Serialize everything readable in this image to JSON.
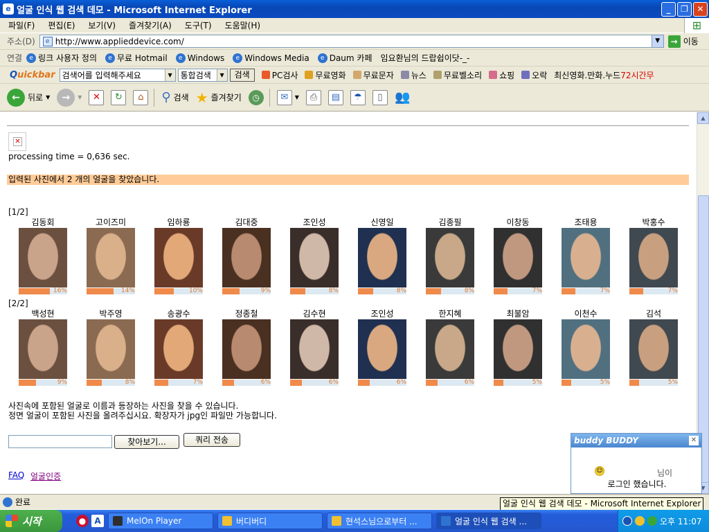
{
  "window": {
    "title": "얼굴 인식 웹 검색 데모 - Microsoft Internet Explorer",
    "icon": "ie-icon",
    "buttons": {
      "minimize": "_",
      "restore": "❐",
      "close": "✕"
    }
  },
  "menu": {
    "items": [
      "파일(F)",
      "편집(E)",
      "보기(V)",
      "즐겨찾기(A)",
      "도구(T)",
      "도움말(H)"
    ]
  },
  "address": {
    "label": "주소(D)",
    "url": "http://www.applieddevice.com/",
    "go_label": "이동"
  },
  "links": {
    "label": "연결",
    "items": [
      "링크 사용자 정의",
      "무료 Hotmail",
      "Windows",
      "Windows Media",
      "Daum 카페"
    ],
    "extra_text": "임요환님의 드랍쉽이닷-_-"
  },
  "quickbar": {
    "logo_q": "Q",
    "logo_rest": "uickbar",
    "search_placeholder": "검색어를 입력해주세요",
    "search_scope": "통합검색",
    "search_button": "검색",
    "items": [
      "PC검사",
      "무료영화",
      "무료문자",
      "뉴스",
      "무료벨소리",
      "쇼핑",
      "오락"
    ],
    "promo_text": "최신영화.만화.누드",
    "promo_red": "72시간무"
  },
  "toolbar": {
    "back_label": "뒤로",
    "search_label": "검색",
    "favorites_label": "즐겨찾기"
  },
  "page": {
    "processing_time": "processing time = 0,636 sec.",
    "found_text": "입력된 사진에서 2 개의 얼굴을 찾았습니다.",
    "group1_label": "[1/2]",
    "group2_label": "[2/2]",
    "group1": [
      {
        "name": "김동회",
        "pct": 16,
        "pct_label": "16%"
      },
      {
        "name": "고이즈미",
        "pct": 14,
        "pct_label": "14%"
      },
      {
        "name": "임하룡",
        "pct": 10,
        "pct_label": "10%"
      },
      {
        "name": "김대중",
        "pct": 9,
        "pct_label": "9%"
      },
      {
        "name": "조인성",
        "pct": 8,
        "pct_label": "8%"
      },
      {
        "name": "신영일",
        "pct": 8,
        "pct_label": "8%"
      },
      {
        "name": "김종필",
        "pct": 8,
        "pct_label": "8%"
      },
      {
        "name": "이창동",
        "pct": 7,
        "pct_label": "7%"
      },
      {
        "name": "조태용",
        "pct": 7,
        "pct_label": "7%"
      },
      {
        "name": "박홍수",
        "pct": 7,
        "pct_label": "7%"
      }
    ],
    "group2": [
      {
        "name": "백성현",
        "pct": 9,
        "pct_label": "9%"
      },
      {
        "name": "박주영",
        "pct": 8,
        "pct_label": "8%"
      },
      {
        "name": "송광수",
        "pct": 7,
        "pct_label": "7%"
      },
      {
        "name": "정종철",
        "pct": 6,
        "pct_label": "6%"
      },
      {
        "name": "김수현",
        "pct": 6,
        "pct_label": "6%"
      },
      {
        "name": "조인성",
        "pct": 6,
        "pct_label": "6%"
      },
      {
        "name": "한지혜",
        "pct": 6,
        "pct_label": "6%"
      },
      {
        "name": "최불암",
        "pct": 5,
        "pct_label": "5%"
      },
      {
        "name": "이천수",
        "pct": 5,
        "pct_label": "5%"
      },
      {
        "name": "김석",
        "pct": 5,
        "pct_label": "5%"
      }
    ],
    "info_line1": "사진속에 포함된 얼굴로 이름과 등장하는 사진을 찾을 수 있습니다.",
    "info_line2": "정면 얼굴이 포함된 사진을 올려주십시요. 확장자가 jpg인 파일만 가능합니다.",
    "browse_button": "찾아보기...",
    "submit_button": "쿼리 전송",
    "faq_link": "FAQ",
    "auth_link": "얼굴인증"
  },
  "buddy": {
    "title_a": "buddy",
    "title_b": "BUDDY",
    "line1": "님이",
    "line2": "로그인 했습니다."
  },
  "status": {
    "text": "완료",
    "tooltip": "얼굴 인식 웹 검색 데모 - Microsoft Internet Explorer"
  },
  "taskbar": {
    "start": "시작",
    "tasks": [
      "MelOn Player",
      "버디버디",
      "현석스님으로부터 ...",
      "얼굴 인식 웹 검색 ..."
    ],
    "clock": "오후 11:07"
  },
  "colors": {
    "found_bg": "#ffcc99",
    "score_fill": "#f08a4b",
    "score_track": "#dce9f2",
    "title_blue": "#0a5fd8"
  }
}
